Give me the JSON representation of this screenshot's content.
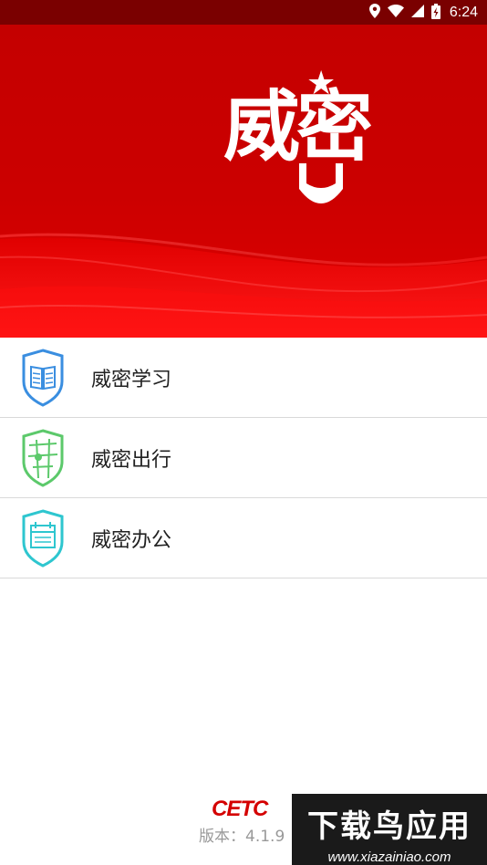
{
  "status_bar": {
    "time": "6:24",
    "icons": [
      "location-icon",
      "wifi-icon",
      "signal-icon",
      "battery-icon"
    ]
  },
  "hero": {
    "logo_text": "威密"
  },
  "menu": {
    "items": [
      {
        "label": "威密学习",
        "icon": "book-shield-icon",
        "color": "#3a8ee0"
      },
      {
        "label": "威密出行",
        "icon": "map-shield-icon",
        "color": "#5cc96b"
      },
      {
        "label": "威密办公",
        "icon": "calendar-shield-icon",
        "color": "#2ec6cf"
      }
    ]
  },
  "footer": {
    "brand": "CETC",
    "version": "版本：4.1.9"
  },
  "watermark": {
    "title": "下载鸟应用",
    "url": "www.xiazainiao.com"
  },
  "colors": {
    "primary": "#cc0000",
    "status_bar": "#7a0000"
  }
}
